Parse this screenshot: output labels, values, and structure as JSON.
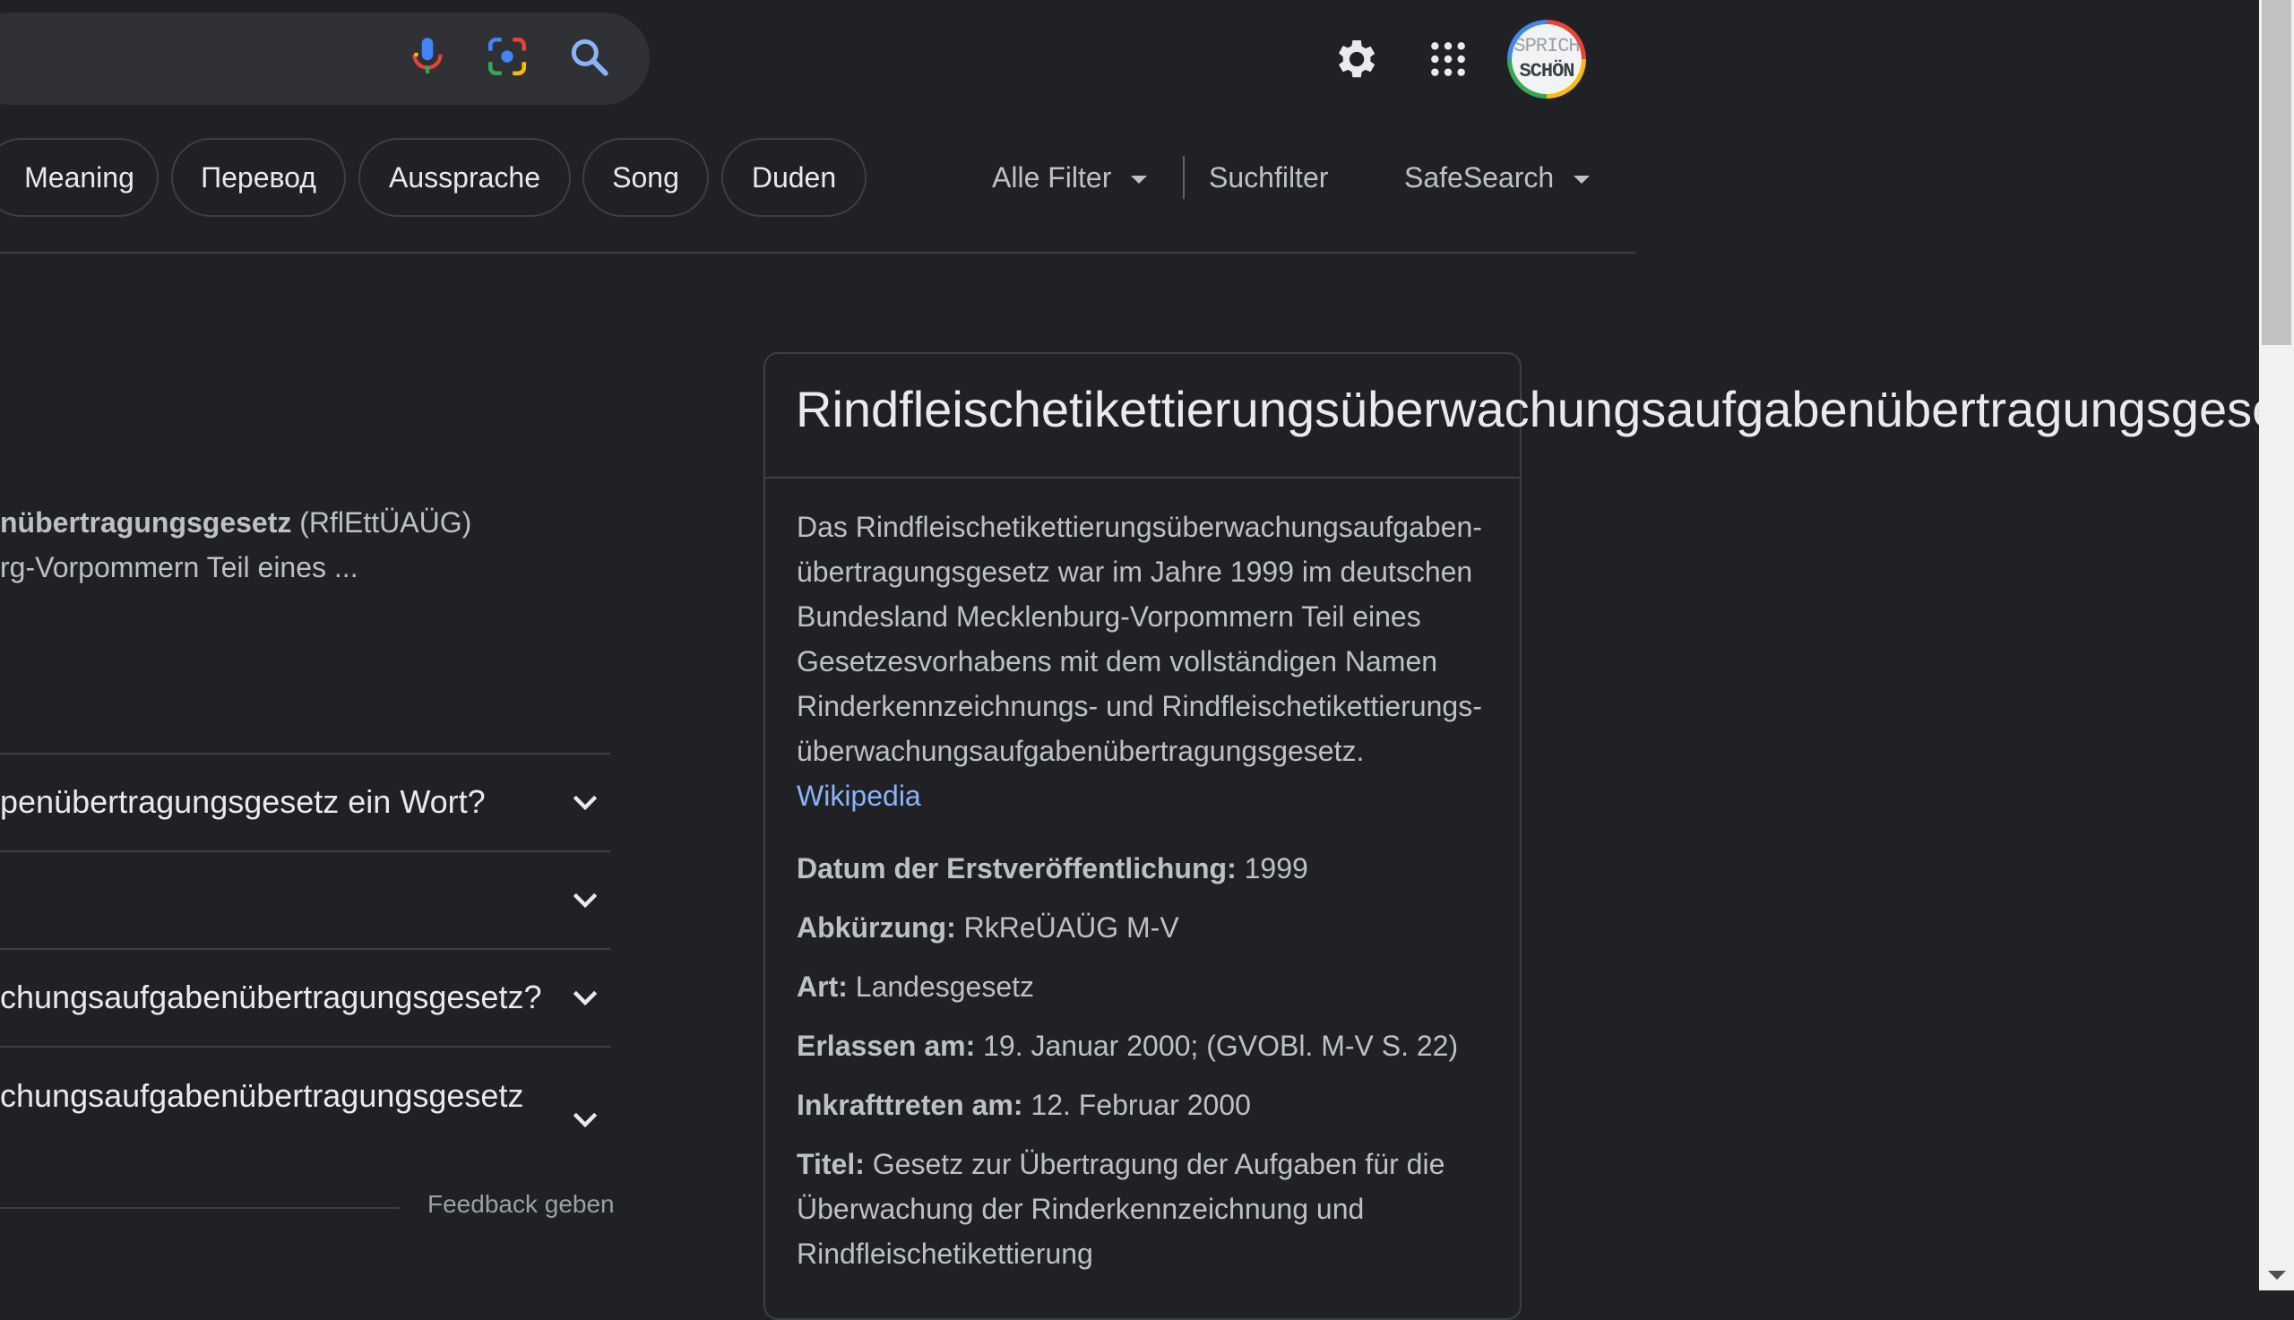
{
  "search": {
    "icons": [
      "microphone-icon",
      "google-lens-icon",
      "search-icon"
    ]
  },
  "header": {
    "icons": [
      "settings-gear-icon",
      "apps-grid-icon"
    ],
    "avatar_text_top": "SPRICH",
    "avatar_text_bottom": "SCHÖN"
  },
  "chips": [
    "Meaning",
    "Перевод",
    "Aussprache",
    "Song",
    "Duden"
  ],
  "filters": {
    "all_filters": "Alle Filter",
    "search_filter": "Suchfilter",
    "safesearch": "SafeSearch"
  },
  "result": {
    "line1_bold": "nübertragungsgesetz",
    "line1_rest": " (RflEttÜAÜG)",
    "line2": "rg-Vorpommern Teil eines ..."
  },
  "paa": [
    "penübertragungsgesetz ein Wort?",
    "",
    "chungsaufgabenübertragungsgesetz?",
    "chungsaufgabenübertragungsgesetz"
  ],
  "feedback": "Feedback geben",
  "knowledge_panel": {
    "title": "Rindfleischetikettierungsüberwachungsaufgabenübertragungsgesetz",
    "desc_lines": [
      "Das Rindfleischetikettierungsüberwachungsaufgaben-",
      "übertragungsgesetz war im Jahre 1999 im deutschen",
      "Bundesland Mecklenburg-Vorpommern Teil eines",
      "Gesetzesvorhabens mit dem vollständigen Namen",
      "Rinderkennzeichnungs- und Rindfleischetikettierungs-",
      "überwachungsaufgabenübertragungsgesetz."
    ],
    "source": "Wikipedia",
    "facts": [
      {
        "key": "Datum der Erstveröffentlichung:",
        "value": " 1999"
      },
      {
        "key": "Abkürzung:",
        "value": " RkReÜAÜG M-V"
      },
      {
        "key": "Art:",
        "value": " Landesgesetz"
      },
      {
        "key": "Erlassen am:",
        "value": " 19. Januar 2000; (GVOBl. M-V S. 22)"
      },
      {
        "key": "Inkrafttreten am:",
        "value": " 12. Februar 2000"
      },
      {
        "key": "Titel:",
        "value": " Gesetz zur Übertragung der Aufgaben für die Überwachung der Rinderkennzeichnung und Rindfleischetikettierung"
      }
    ]
  },
  "colors": {
    "background": "#202124",
    "text": "#e8eaed",
    "link": "#8ab4f8"
  }
}
